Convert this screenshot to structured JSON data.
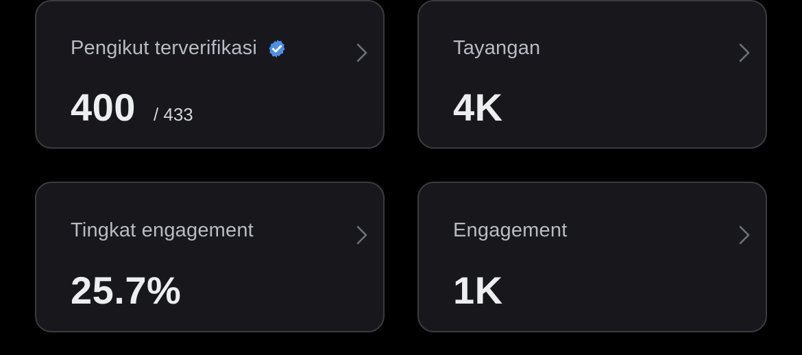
{
  "cards": [
    {
      "title": "Pengikut terverifikasi",
      "value": "400",
      "sub_value": "/ 433",
      "icon": "verified-badge-icon",
      "badge_color": "#4a90e8"
    },
    {
      "title": "Tayangan",
      "value": "4K"
    },
    {
      "title": "Tingkat engagement",
      "value": "25.7%"
    },
    {
      "title": "Engagement",
      "value": "1K"
    }
  ],
  "theme": {
    "background": "#000000",
    "card_background": "#18181c",
    "card_border": "#3a3a3f",
    "title_color": "#b8bcc2",
    "value_color": "#eceef0",
    "chevron_color": "#6e737a"
  }
}
